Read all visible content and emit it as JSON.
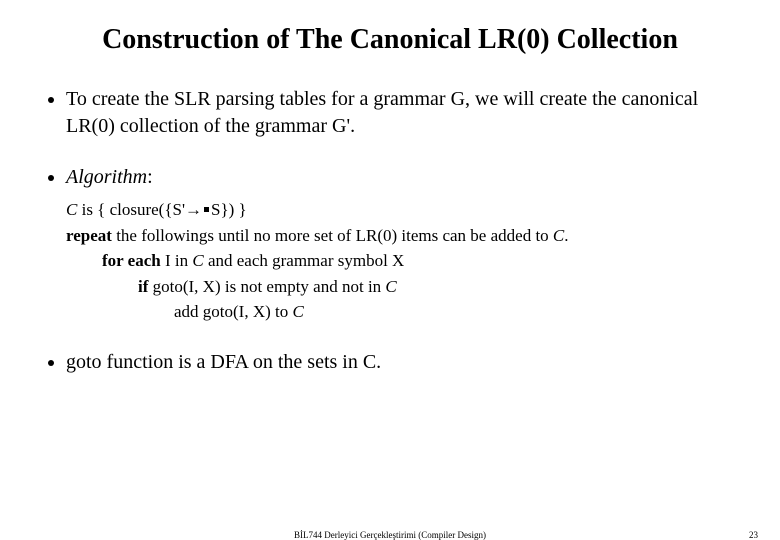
{
  "title": "Construction of The Canonical LR(0) Collection",
  "bullets": {
    "b1": "To create the SLR parsing tables for a grammar G, we will create the canonical LR(0) collection of the grammar G'.",
    "algo_label": "Algorithm",
    "algo": {
      "c_pre": "C",
      "line1_rest": " is { closure({S'→",
      "line1_tail": "S}) }",
      "repeat_word": "repeat",
      "line2_rest": " the followings until no more set of LR(0) items can be added to ",
      "line2_C": "C",
      "line2_period": ".",
      "foreach": "for each",
      "line3_rest": " I in ",
      "line3_C": "C",
      "line3_rest2": " and each grammar symbol X",
      "if_word": "if",
      "line4_rest": " goto(I, X) is not empty and not in ",
      "line4_C": "C",
      "line5": "add goto(I, X) to ",
      "line5_C": "C"
    },
    "b3": "goto function is a DFA on the sets in C."
  },
  "footer": {
    "course": "BİL744 Derleyici Gerçekleştirimi (Compiler Design)",
    "page": "23"
  }
}
